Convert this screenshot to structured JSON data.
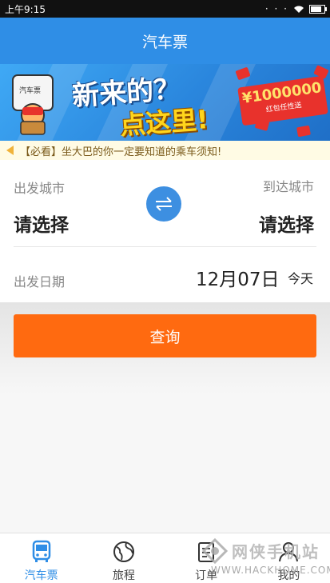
{
  "status_bar": {
    "time": "上午9:15",
    "signal_dots": "· · ·",
    "battery_level": 0.8
  },
  "header": {
    "title": "汽车票"
  },
  "banner": {
    "headline": "新来的？",
    "subheadline": "点这里!",
    "amount": "¥1000000",
    "amount_sub": "红包任性送",
    "mascot_sign": "汽车票"
  },
  "notice": {
    "text": "【必看】坐大巴的你一定要知道的乘车须知!"
  },
  "search_form": {
    "from_label": "出发城市",
    "from_value": "请选择",
    "to_label": "到达城市",
    "to_value": "请选择",
    "date_label": "出发日期",
    "date_value": "12月07日",
    "date_sub": "今天"
  },
  "query_button": {
    "label": "查询"
  },
  "tabs": [
    {
      "label": "汽车票",
      "icon": "bus-icon",
      "active": true
    },
    {
      "label": "旅程",
      "icon": "globe-icon",
      "active": false
    },
    {
      "label": "订单",
      "icon": "order-icon",
      "active": false
    },
    {
      "label": "我的",
      "icon": "user-icon",
      "active": false
    }
  ],
  "watermark": {
    "name": "网侠手机站",
    "url": "WWW.HACKHOME.COM"
  },
  "colors": {
    "primary": "#2f8ee6",
    "accent": "#ff6a10",
    "swap": "#3d8fe1"
  }
}
